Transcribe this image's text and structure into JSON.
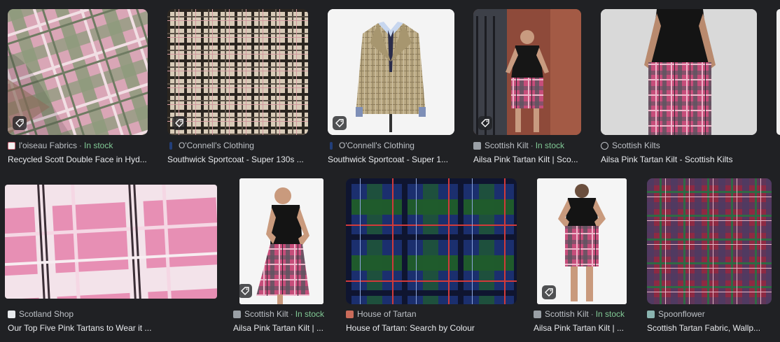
{
  "colors": {
    "background": "#202124",
    "meta_text": "#bdc1c6",
    "title_text": "#e8eaed",
    "in_stock": "#81c995"
  },
  "results": [
    {
      "source": "l'oiseau Fabrics",
      "stock": "In stock",
      "title": "Recycled Scott Double Face in Hyd...",
      "favicon": "fabric-icon",
      "has_tag": true
    },
    {
      "source": "O'Connell's Clothing",
      "stock": "",
      "title": "Southwick Sportcoat - Super 130s ...",
      "favicon": "oconnells-icon",
      "has_tag": true
    },
    {
      "source": "O'Connell's Clothing",
      "stock": "",
      "title": "Southwick Sportcoat - Super 1...",
      "favicon": "oconnells-icon",
      "has_tag": true
    },
    {
      "source": "Scottish Kilt",
      "stock": "In stock",
      "title": "Ailsa Pink Tartan Kilt | Sco...",
      "favicon": "kilt-icon",
      "has_tag": true
    },
    {
      "source": "Scottish Kilts",
      "stock": "",
      "title": "Ailsa Pink Tartan Kilt - Scottish Kilts",
      "favicon": "globe-icon",
      "has_tag": false
    },
    {
      "source": "Scotland Shop",
      "stock": "",
      "title": "Our Top Five Pink Tartans to Wear it ...",
      "favicon": "scotland-shop-icon",
      "has_tag": false
    },
    {
      "source": "Scottish Kilt",
      "stock": "In stock",
      "title": "Ailsa Pink Tartan Kilt | ...",
      "favicon": "kilt-icon",
      "has_tag": true
    },
    {
      "source": "House of Tartan",
      "stock": "",
      "title": "House of Tartan: Search by Colour",
      "favicon": "house-of-tartan-icon",
      "has_tag": false
    },
    {
      "source": "Scottish Kilt",
      "stock": "In stock",
      "title": "Ailsa Pink Tartan Kilt | ...",
      "favicon": "kilt-icon",
      "has_tag": true
    },
    {
      "source": "Spoonflower",
      "stock": "",
      "title": "Scottish Tartan Fabric, Wallp...",
      "favicon": "spoonflower-icon",
      "has_tag": false
    }
  ]
}
